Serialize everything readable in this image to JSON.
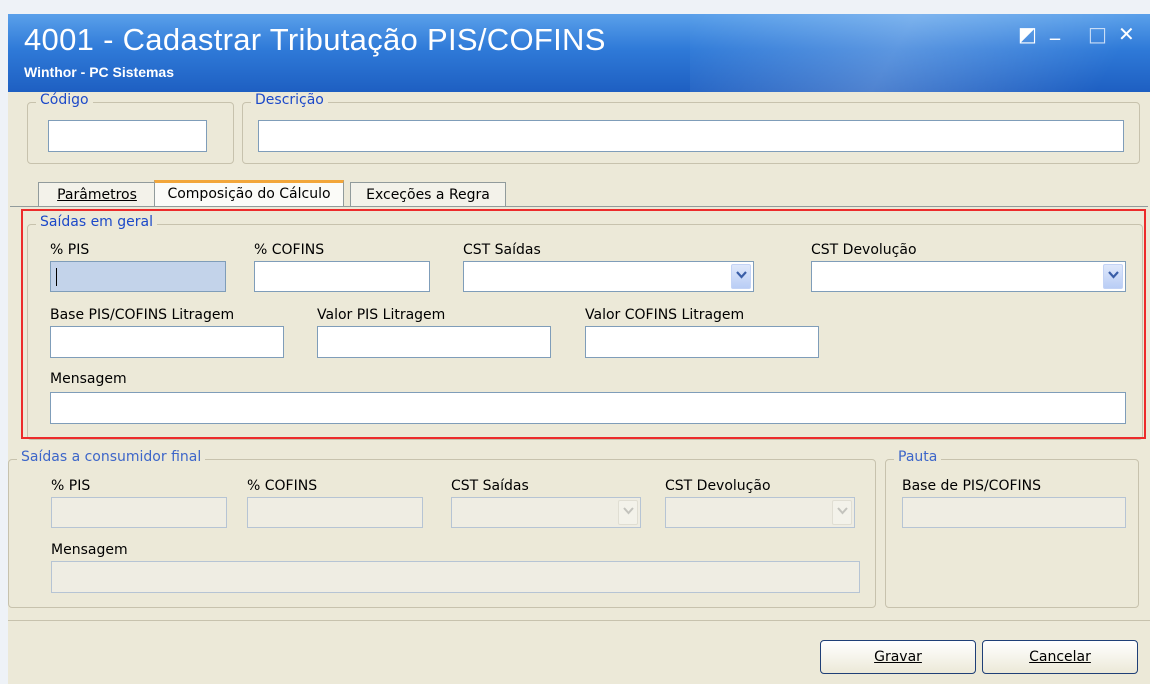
{
  "window": {
    "title": "4001 - Cadastrar Tributação PIS/COFINS",
    "subtitle": "Winthor - PC Sistemas",
    "restore_icon": "◩",
    "minimize_icon": "_",
    "maximize_icon": "□",
    "close_icon": "✕"
  },
  "header": {
    "codigo_label": "Código",
    "codigo_value": "",
    "descricao_label": "Descrição",
    "descricao_value": ""
  },
  "tabs": [
    {
      "label": "Parâmetros",
      "active": false
    },
    {
      "label": "Composição do Cálculo",
      "active": true
    },
    {
      "label": "Exceções a Regra",
      "active": false
    }
  ],
  "saidas_geral": {
    "legend": "Saídas em geral",
    "pis_label": "% PIS",
    "pis_value": "",
    "cofins_label": "% COFINS",
    "cofins_value": "",
    "cst_saidas_label": "CST Saídas",
    "cst_saidas_value": "",
    "cst_devolucao_label": "CST Devolução",
    "cst_devolucao_value": "",
    "base_litragem_label": "Base PIS/COFINS Litragem",
    "valor_pis_litragem_label": "Valor PIS Litragem",
    "valor_cofins_litragem_label": "Valor COFINS Litragem",
    "mensagem_label": "Mensagem",
    "mensagem_value": ""
  },
  "saidas_consumidor": {
    "legend": "Saídas a consumidor final",
    "pis_label": "% PIS",
    "cofins_label": "% COFINS",
    "cst_saidas_label": "CST Saídas",
    "cst_devolucao_label": "CST Devolução",
    "mensagem_label": "Mensagem"
  },
  "pauta": {
    "legend": "Pauta",
    "base_label": "Base de PIS/COFINS"
  },
  "buttons": {
    "gravar": "Gravar",
    "cancelar": "Cancelar"
  },
  "colors": {
    "title_bar": "#2f7ad8",
    "legend_text": "#1c49c9",
    "highlight": "#ec2b2b",
    "window_bg": "#ece9d8"
  }
}
